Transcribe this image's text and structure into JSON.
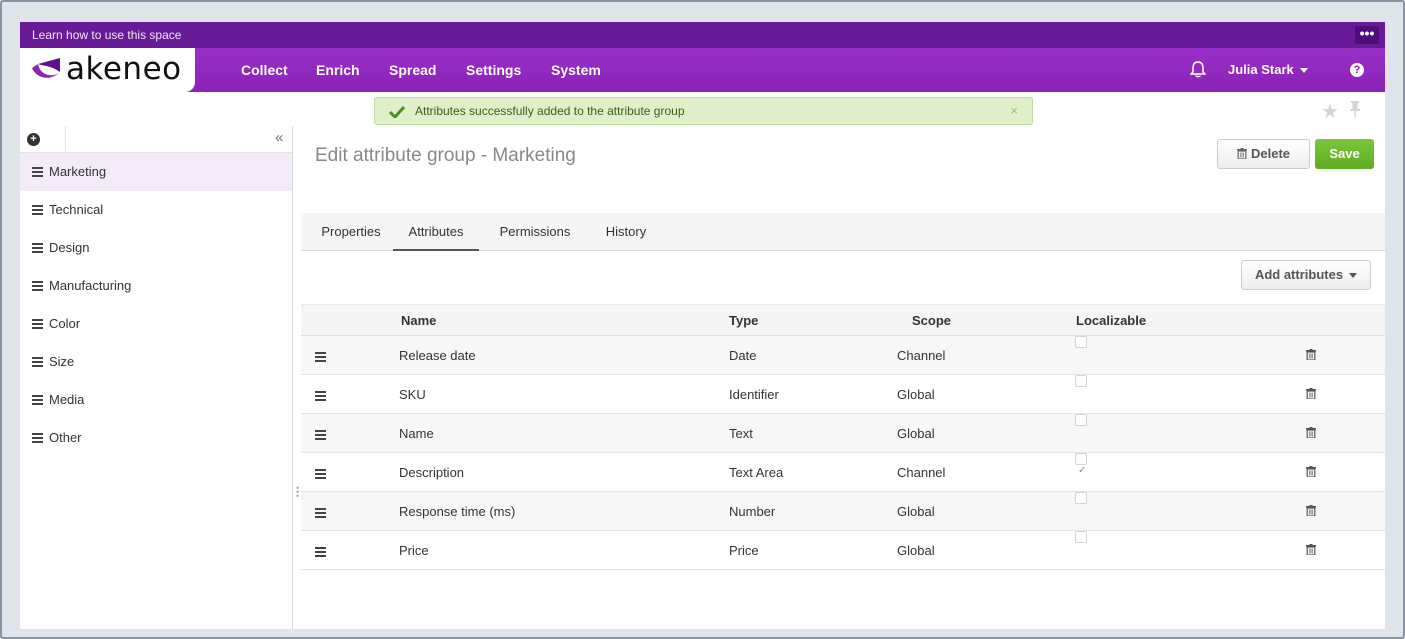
{
  "learn_bar": {
    "text": "Learn how to use this space",
    "more": "•••"
  },
  "brand": {
    "name": "akeneo",
    "color": "#8a23b8"
  },
  "nav": {
    "items": [
      "Collect",
      "Enrich",
      "Spread",
      "Settings",
      "System"
    ]
  },
  "user": {
    "name": "Julia Stark",
    "help": "?"
  },
  "flash": {
    "message": "Attributes successfully added to the attribute group",
    "close": "×"
  },
  "sidebar": {
    "collapse": "«",
    "items": [
      {
        "label": "Marketing",
        "active": true
      },
      {
        "label": "Technical"
      },
      {
        "label": "Design"
      },
      {
        "label": "Manufacturing"
      },
      {
        "label": "Color"
      },
      {
        "label": "Size"
      },
      {
        "label": "Media"
      },
      {
        "label": "Other"
      }
    ]
  },
  "page": {
    "title": "Edit attribute group - Marketing",
    "delete_label": "Delete",
    "save_label": "Save",
    "add_attributes_label": "Add attributes"
  },
  "tabs": [
    {
      "label": "Properties"
    },
    {
      "label": "Attributes",
      "active": true
    },
    {
      "label": "Permissions"
    },
    {
      "label": "History"
    }
  ],
  "table": {
    "columns": [
      "Name",
      "Type",
      "Scope",
      "Localizable"
    ],
    "rows": [
      {
        "name": "Release date",
        "type": "Date",
        "scope": "Channel",
        "localizable": false
      },
      {
        "name": "SKU",
        "type": "Identifier",
        "scope": "Global",
        "localizable": false
      },
      {
        "name": "Name",
        "type": "Text",
        "scope": "Global",
        "localizable": false
      },
      {
        "name": "Description",
        "type": "Text Area",
        "scope": "Channel",
        "localizable": true
      },
      {
        "name": "Response time (ms)",
        "type": "Number",
        "scope": "Global",
        "localizable": false
      },
      {
        "name": "Price",
        "type": "Price",
        "scope": "Global",
        "localizable": false
      }
    ]
  }
}
